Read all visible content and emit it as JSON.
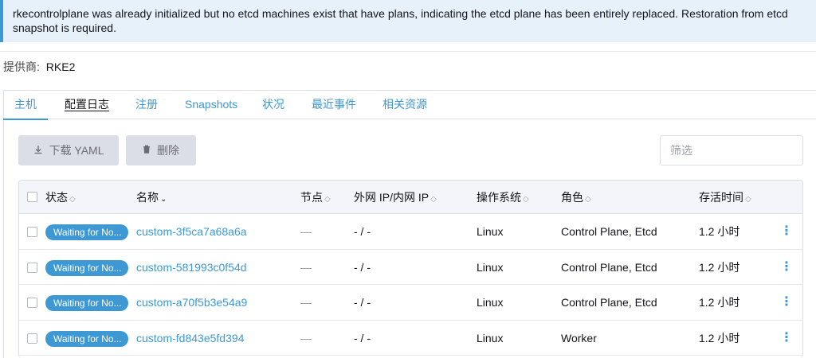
{
  "banner": {
    "message": "rkecontrolplane was already initialized but no etcd machines exist that have plans, indicating the etcd plane has been entirely replaced. Restoration from etcd snapshot is required."
  },
  "provider": {
    "label": "提供商:",
    "value": "RKE2"
  },
  "tabs": [
    {
      "label": "主机"
    },
    {
      "label": "配置日志"
    },
    {
      "label": "注册"
    },
    {
      "label": "Snapshots"
    },
    {
      "label": "状况"
    },
    {
      "label": "最近事件"
    },
    {
      "label": "相关资源"
    }
  ],
  "toolbar": {
    "download_label": "下载 YAML",
    "delete_label": "删除",
    "filter_placeholder": "筛选"
  },
  "table": {
    "headers": {
      "state": "状态",
      "name": "名称",
      "node": "节点",
      "ip": "外网 IP/内网 IP",
      "os": "操作系统",
      "role": "角色",
      "age": "存活时间"
    },
    "rows": [
      {
        "state": "Waiting for No...",
        "name": "custom-3f5ca7a68a6a",
        "node": "—",
        "ip": "- / -",
        "os": "Linux",
        "role": "Control Plane, Etcd",
        "age": "1.2 小时"
      },
      {
        "state": "Waiting for No...",
        "name": "custom-581993c0f54d",
        "node": "—",
        "ip": "- / -",
        "os": "Linux",
        "role": "Control Plane, Etcd",
        "age": "1.2 小时"
      },
      {
        "state": "Waiting for No...",
        "name": "custom-a70f5b3e54a9",
        "node": "—",
        "ip": "- / -",
        "os": "Linux",
        "role": "Control Plane, Etcd",
        "age": "1.2 小时"
      },
      {
        "state": "Waiting for No...",
        "name": "custom-fd843e5fd394",
        "node": "—",
        "ip": "- / -",
        "os": "Linux",
        "role": "Worker",
        "age": "1.2 小时"
      }
    ]
  },
  "colors": {
    "accent": "#3d98d3",
    "banner_bg": "#e6f1fa",
    "button_bg": "#dcdee7"
  }
}
